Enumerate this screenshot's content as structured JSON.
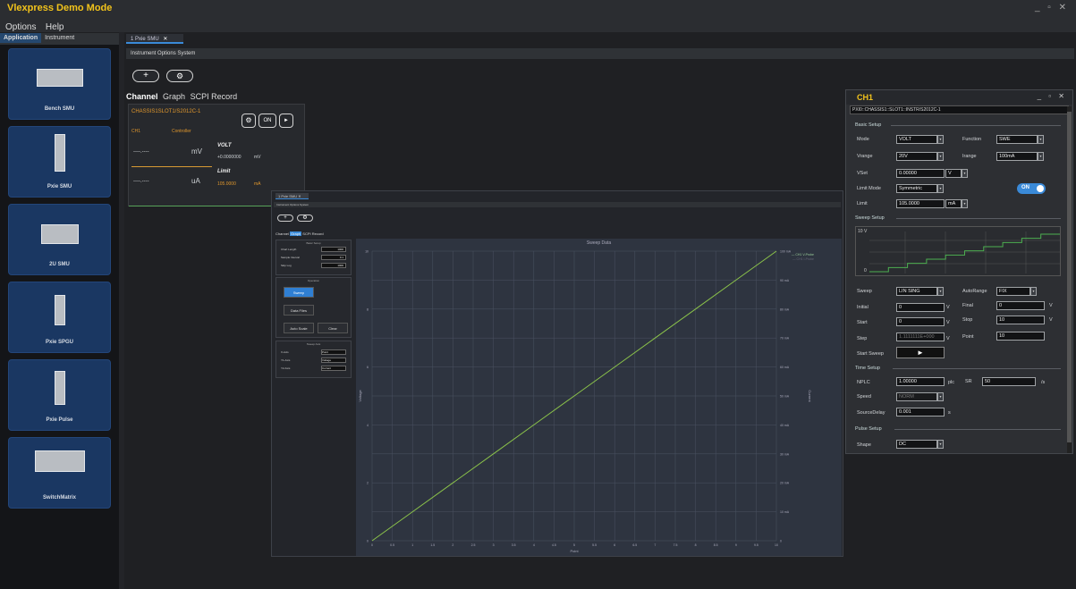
{
  "app": {
    "title": "Vlexpress Demo Mode",
    "window_controls": "_ ▫ ✕"
  },
  "menu": {
    "options": "Options",
    "help": "Help"
  },
  "left_tabs": {
    "application": "Application",
    "instrument": "Instrument"
  },
  "devices": [
    {
      "label": "Bench SMU"
    },
    {
      "label": "Pxie SMU"
    },
    {
      "label": "2U SMU"
    },
    {
      "label": "Pxie SPGU"
    },
    {
      "label": "Pxie Pulse"
    },
    {
      "label": "SwitchMatrix"
    }
  ],
  "doc_tab": {
    "label": "1 Pxie SMU",
    "close": "✕"
  },
  "inst_menu": {
    "instrument": "Instrument",
    "options": "Options",
    "system": "System"
  },
  "channel_tabs": {
    "channel": "Channel",
    "graph": "Graph",
    "scpi": "SCPI Record"
  },
  "channel_card": {
    "address": "CHASSIS1SLOT1/S2012C-1",
    "ch": "CH1",
    "controller": "Controller",
    "meas1_dash": "----.----",
    "meas1_unit": "mV",
    "meas2_dash": "----.----",
    "meas2_unit": "uA",
    "volt_label": "VOLT",
    "volt_value": "+0.0000000",
    "volt_unit": "mV",
    "limit_label": "Limit",
    "limit_value": "105.0000",
    "limit_unit": "mA",
    "on_label": "ON",
    "run_icon": "►",
    "gear_icon": "⚙"
  },
  "graph_window": {
    "tab": "1 Pxie SMU",
    "tab_close": "✕",
    "menu": "Instrument  Options  System",
    "tabs": {
      "channel": "Channel",
      "graph": "Graph",
      "scpi": "SCPI Record"
    },
    "basic_setup": {
      "title": "Basic Setup",
      "rows": [
        {
          "label": "Chart Length",
          "value": "1000"
        },
        {
          "label": "Sample Interval",
          "value": "0.1"
        },
        {
          "label": "Skip Log",
          "value": "1000"
        }
      ]
    },
    "operation": {
      "title": "Operation",
      "sweep": "Sweep",
      "data_files": "Data Files",
      "auto_scale": "Auto Scale",
      "clear": "Clear"
    },
    "sweep_axis": {
      "title": "Sweep Axis",
      "rows": [
        {
          "label": "X-Axis",
          "value": "Point"
        },
        {
          "label": "Y1-Axis",
          "value": "Voltage"
        },
        {
          "label": "Y2-Axis",
          "value": "Current"
        }
      ]
    },
    "plot": {
      "title": "Sweep Data",
      "xlabel": "Point",
      "y1label": "Voltage",
      "y2label": "Current",
      "legend1": "CH1 V-Probe",
      "legend2": "CH1 I-Probe"
    }
  },
  "chart_data": {
    "type": "line",
    "title": "Sweep Data",
    "xlabel": "Point",
    "ylabel": "Voltage",
    "y2label": "Current",
    "x": [
      0,
      1,
      2,
      3,
      4,
      5,
      6,
      7,
      8,
      9,
      10
    ],
    "series": [
      {
        "name": "CH1 V-Probe",
        "values": [
          0,
          1,
          2,
          3,
          4,
          5,
          6,
          7,
          8,
          9,
          10
        ]
      }
    ],
    "xlim": [
      0,
      10
    ],
    "ylim": [
      0,
      10
    ],
    "y2lim": [
      0,
      100
    ],
    "x_ticks": [
      "0",
      "0.5",
      "1",
      "1.5",
      "2",
      "2.5",
      "3",
      "3.5",
      "4",
      "4.5",
      "5",
      "5.5",
      "6",
      "6.5",
      "7",
      "7.5",
      "8",
      "8.5",
      "9",
      "9.5",
      "10"
    ],
    "y_ticks": [
      "0",
      "2",
      "4",
      "6",
      "8",
      "10"
    ],
    "y2_ticks": [
      "0",
      "10 mA",
      "20 mA",
      "30 mA",
      "40 mA",
      "50 mA",
      "60 mA",
      "70 mA",
      "80 mA",
      "90 mA",
      "100 mA"
    ],
    "grid": true,
    "legend": "top-right",
    "line_color": "#8bc34a"
  },
  "ch1_panel": {
    "title": "CH1",
    "window_controls": "_ ▫ ✕",
    "address": "PXI0::CHASSIS1::SLOT1::INSTR/S2012C-1",
    "basic_setup": "Basic Setup",
    "mode_label": "Mode",
    "mode_value": "VOLT",
    "function_label": "Function",
    "function_value": "SWE",
    "vrange_label": "Vrange",
    "vrange_value": "20V",
    "irange_label": "Irange",
    "irange_value": "100mA",
    "vset_label": "VSet",
    "vset_value": "0.00000",
    "vset_unit": "V",
    "limit_mode_label": "Limit Mode",
    "limit_mode_value": "Symmetric",
    "toggle_label": "ON",
    "limit_label": "Limit",
    "limit_value": "105.0000",
    "limit_unit": "mA",
    "sweep_setup": "Sweep Setup",
    "preview_y_max": "10 V",
    "preview_y_min": "0",
    "sweep_label": "Sweep",
    "sweep_value": "LIN SING",
    "autorange_label": "AutoRange",
    "autorange_value": "FIX",
    "initial_label": "Initial",
    "initial_value": "0",
    "initial_unit": "V",
    "final_label": "Final",
    "final_value": "0",
    "final_unit": "V",
    "start_label": "Start",
    "start_value": "0",
    "start_unit": "V",
    "stop_label": "Stop",
    "stop_value": "10",
    "stop_unit": "V",
    "step_label": "Step",
    "step_value": "1.1111111E+000",
    "step_unit": "V",
    "point_label": "Point",
    "point_value": "10",
    "start_sweep_label": "Start Sweep",
    "time_setup": "Time Setup",
    "nplc_label": "NPLC",
    "nplc_value": "1.00000",
    "nplc_unit": "plc",
    "sr_label": "SR",
    "sr_value": "50",
    "sr_unit": "/s",
    "speed_label": "Speed",
    "speed_value": "NORM",
    "source_delay_label": "SourceDelay",
    "source_delay_value": "0.001",
    "source_delay_unit": "s",
    "pulse_setup": "Pulse Setup",
    "shape_label": "Shape",
    "shape_value": "DC"
  },
  "colors": {
    "accent": "#f2c31b",
    "toggle": "#3a8ad8",
    "curve": "#8bc34a"
  }
}
